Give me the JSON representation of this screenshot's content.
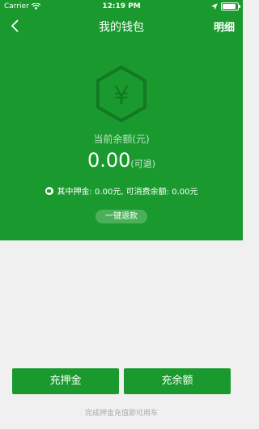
{
  "status_bar": {
    "carrier": "Carrier",
    "time": "12:19 PM",
    "battery_level": 0.9
  },
  "nav": {
    "title": "我的钱包",
    "detail_label": "明细"
  },
  "wallet": {
    "currency_symbol": "¥",
    "balance_label": "当前余额(元)",
    "balance_amount": "0.00",
    "refundable_note": "(可退)",
    "breakdown_text": "其中押金: 0.00元, 可消费余额: 0.00元",
    "refund_button": "一键退款"
  },
  "actions": {
    "deposit_button": "充押金",
    "balance_button": "充余额",
    "hint": "完成押金充值即可用车"
  },
  "colors": {
    "primary_green": "#1a9a2e",
    "background": "#f0f0f0"
  }
}
